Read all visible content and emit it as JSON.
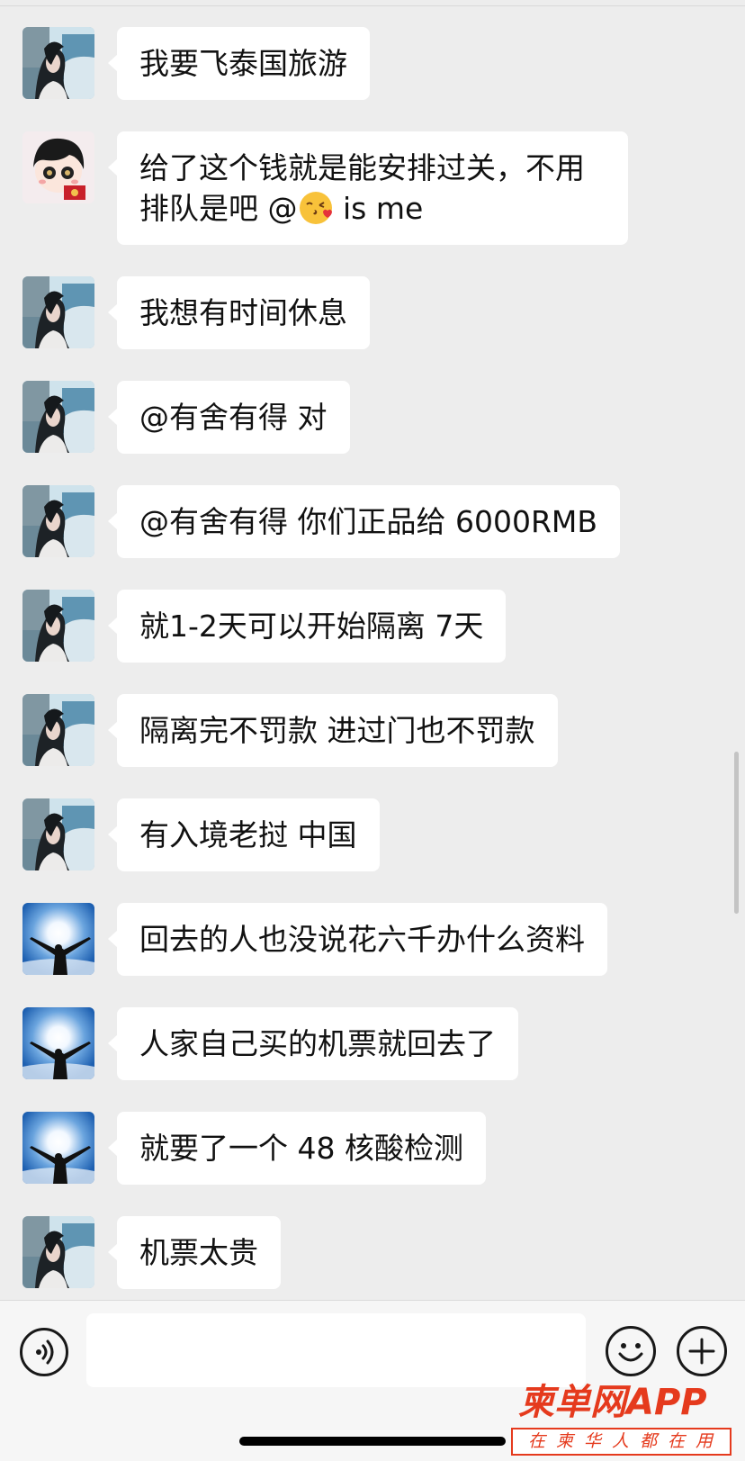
{
  "colors": {
    "background": "#ededed",
    "bubble": "#ffffff",
    "text": "#111111",
    "watermark": "#e53a1d"
  },
  "messages": [
    {
      "sender": "girl-avatar",
      "text": "我要飞泰国旅游"
    },
    {
      "sender": "cartoon-avatar",
      "line1": "给了这个钱就是能安排过关，不用",
      "line2_pre": "排队是吧 @",
      "emoji": "face-blowing-kiss",
      "line2_post": " is me"
    },
    {
      "sender": "girl-avatar",
      "text": "我想有时间休息"
    },
    {
      "sender": "girl-avatar",
      "text": "@有舍有得 对"
    },
    {
      "sender": "girl-avatar",
      "text": "@有舍有得 你们正品给 6000RMB"
    },
    {
      "sender": "girl-avatar",
      "text": "就1-2天可以开始隔离 7天"
    },
    {
      "sender": "girl-avatar",
      "text": "隔离完不罚款 进过门也不罚款"
    },
    {
      "sender": "girl-avatar",
      "text": "有入境老挝 中国"
    },
    {
      "sender": "sky-avatar",
      "text": "回去的人也没说花六千办什么资料"
    },
    {
      "sender": "sky-avatar",
      "text": "人家自己买的机票就回去了"
    },
    {
      "sender": "sky-avatar",
      "text": "就要了一个 48 核酸检测"
    },
    {
      "sender": "girl-avatar",
      "text": "机票太贵"
    }
  ],
  "input_bar": {
    "voice_icon": "voice-icon",
    "emoji_icon": "smiley-icon",
    "plus_icon": "plus-icon",
    "input_value": ""
  },
  "watermark": {
    "brand": "柬单网APP",
    "slogan": "在柬华人都在用"
  }
}
